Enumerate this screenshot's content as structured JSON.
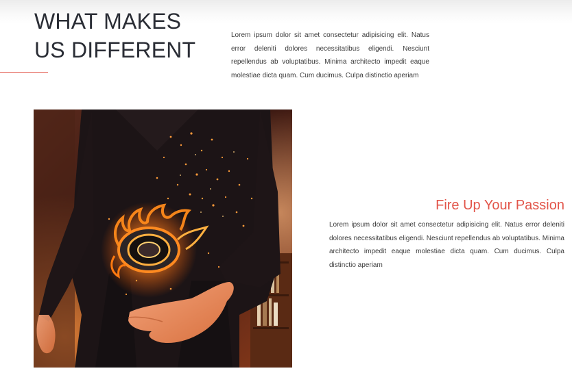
{
  "section": {
    "title_line1": "WHAT MAKES",
    "title_line2": "US DIFFERENT",
    "intro": "Lorem ipsum dolor sit amet consectetur adipisicing elit. Natus error deleniti dolores necessitatibus eligendi. Nesciunt repellendus ab voluptatibus. Minima architecto impedit eaque molestiae dicta quam. Cum ducimus. Culpa distinctio aperiam"
  },
  "feature": {
    "title": "Fire Up Your Passion",
    "text": "Lorem ipsum dolor sit amet consectetur adipisicing elit. Natus error deleniti dolores necessitatibus eligendi. Nesciunt repellendus ab voluptatibus. Minima architecto impedit eaque molestiae dicta quam. Cum ducimus. Culpa distinctio aperiam",
    "image_icon": "flaming-camera-lens-photo"
  },
  "colors": {
    "accent": "#e2554a",
    "heading": "#2a2d35",
    "body_text": "#3b3b3b"
  }
}
